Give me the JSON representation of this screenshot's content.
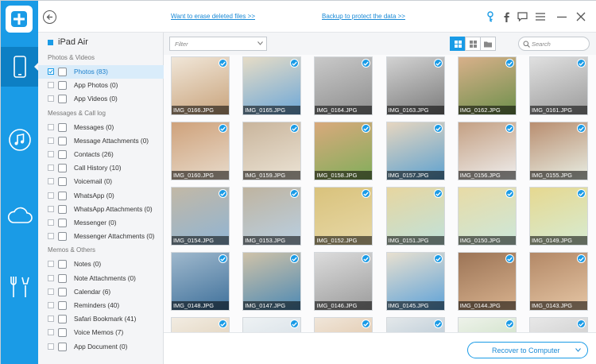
{
  "topbar": {
    "link_erase": "Want to erase deleted files >>",
    "link_backup": "Backup to protect the data >>"
  },
  "sidebar": {
    "device": "iPad Air",
    "sections": [
      {
        "title": "Photos & Videos",
        "items": [
          {
            "label": "Photos (83)",
            "selected": true,
            "icon": "photo-icon"
          },
          {
            "label": "App Photos (0)",
            "selected": false,
            "icon": "app-photo-icon"
          },
          {
            "label": "App Videos (0)",
            "selected": false,
            "icon": "app-video-icon"
          }
        ]
      },
      {
        "title": "Messages & Call log",
        "items": [
          {
            "label": "Messages (0)",
            "selected": false,
            "icon": "message-icon"
          },
          {
            "label": "Message Attachments (0)",
            "selected": false,
            "icon": "attachment-icon"
          },
          {
            "label": "Contacts (26)",
            "selected": false,
            "icon": "contact-icon"
          },
          {
            "label": "Call History (10)",
            "selected": false,
            "icon": "phone-icon"
          },
          {
            "label": "Voicemail (0)",
            "selected": false,
            "icon": "voicemail-icon"
          },
          {
            "label": "WhatsApp (0)",
            "selected": false,
            "icon": "whatsapp-icon"
          },
          {
            "label": "WhatsApp Attachments (0)",
            "selected": false,
            "icon": "whatsapp-attachment-icon"
          },
          {
            "label": "Messenger (0)",
            "selected": false,
            "icon": "messenger-icon"
          },
          {
            "label": "Messenger Attachments (0)",
            "selected": false,
            "icon": "messenger-attachment-icon"
          }
        ]
      },
      {
        "title": "Memos & Others",
        "items": [
          {
            "label": "Notes (0)",
            "selected": false,
            "icon": "notes-icon"
          },
          {
            "label": "Note Attachments (0)",
            "selected": false,
            "icon": "note-attachment-icon"
          },
          {
            "label": "Calendar (6)",
            "selected": false,
            "icon": "calendar-icon"
          },
          {
            "label": "Reminders (40)",
            "selected": false,
            "icon": "reminder-icon"
          },
          {
            "label": "Safari Bookmark (41)",
            "selected": false,
            "icon": "bookmark-icon"
          },
          {
            "label": "Voice Memos (7)",
            "selected": false,
            "icon": "voice-memo-icon"
          },
          {
            "label": "App Document (0)",
            "selected": false,
            "icon": "document-icon"
          }
        ]
      }
    ]
  },
  "toolbar": {
    "filter_value": "Filter",
    "search_placeholder": "Search"
  },
  "photos": [
    {
      "name": "IMG_0166.JPG",
      "checked": true,
      "c1": "#c8a27a",
      "c2": "#f0e6d8"
    },
    {
      "name": "IMG_0165.JPG",
      "checked": true,
      "c1": "#6aa6d8",
      "c2": "#e6dcc6"
    },
    {
      "name": "IMG_0164.JPG",
      "checked": true,
      "c1": "#8d8d8d",
      "c2": "#c9c9c9"
    },
    {
      "name": "IMG_0163.JPG",
      "checked": true,
      "c1": "#7a7a7a",
      "c2": "#d2d2d2"
    },
    {
      "name": "IMG_0162.JPG",
      "checked": true,
      "c1": "#6b8f4a",
      "c2": "#d8b08a"
    },
    {
      "name": "IMG_0161.JPG",
      "checked": true,
      "c1": "#9a9a9a",
      "c2": "#e0e0e0"
    },
    {
      "name": "IMG_0160.JPG",
      "checked": true,
      "c1": "#e8dccd",
      "c2": "#cfa27b"
    },
    {
      "name": "IMG_0159.JPG",
      "checked": true,
      "c1": "#ece4d6",
      "c2": "#c9b59c"
    },
    {
      "name": "IMG_0158.JPG",
      "checked": true,
      "c1": "#7fae5a",
      "c2": "#d9a97c"
    },
    {
      "name": "IMG_0157.JPG",
      "checked": true,
      "c1": "#5aa0d0",
      "c2": "#e6d6c0"
    },
    {
      "name": "IMG_0156.JPG",
      "checked": true,
      "c1": "#f0f0f0",
      "c2": "#c4a083"
    },
    {
      "name": "IMG_0155.JPG",
      "checked": true,
      "c1": "#e9f0e6",
      "c2": "#b98e70"
    },
    {
      "name": "IMG_0154.JPG",
      "checked": true,
      "c1": "#8fb4d4",
      "c2": "#c2b8a6"
    },
    {
      "name": "IMG_0153.JPG",
      "checked": true,
      "c1": "#b9d0e4",
      "c2": "#bfb4a0"
    },
    {
      "name": "IMG_0152.JPG",
      "checked": true,
      "c1": "#e7d9a8",
      "c2": "#d9c27c"
    },
    {
      "name": "IMG_0151.JPG",
      "checked": true,
      "c1": "#bfe2dc",
      "c2": "#e7d6a0"
    },
    {
      "name": "IMG_0150.JPG",
      "checked": true,
      "c1": "#cbe8dc",
      "c2": "#e8dba6"
    },
    {
      "name": "IMG_0149.JPG",
      "checked": true,
      "c1": "#d6ecd4",
      "c2": "#e6d890"
    },
    {
      "name": "IMG_0148.JPG",
      "checked": true,
      "c1": "#3d6f9a",
      "c2": "#9fb8cc"
    },
    {
      "name": "IMG_0147.JPG",
      "checked": true,
      "c1": "#4a88b4",
      "c2": "#cfc2a8"
    },
    {
      "name": "IMG_0146.JPG",
      "checked": true,
      "c1": "#9a9a9a",
      "c2": "#dcdcdc"
    },
    {
      "name": "IMG_0145.JPG",
      "checked": true,
      "c1": "#5aa0d8",
      "c2": "#e8e0d0"
    },
    {
      "name": "IMG_0144.JPG",
      "checked": true,
      "c1": "#d9b38f",
      "c2": "#9c7456"
    },
    {
      "name": "IMG_0143.JPG",
      "checked": true,
      "c1": "#e6c7a6",
      "c2": "#b38866"
    },
    {
      "name": "",
      "checked": true,
      "c1": "#d6c2a4",
      "c2": "#f2ece2"
    },
    {
      "name": "",
      "checked": true,
      "c1": "#c8d4de",
      "c2": "#eef2f4"
    },
    {
      "name": "",
      "checked": true,
      "c1": "#d8b48c",
      "c2": "#f0e6da"
    },
    {
      "name": "",
      "checked": true,
      "c1": "#9ab4c8",
      "c2": "#e4e8ea"
    },
    {
      "name": "",
      "checked": true,
      "c1": "#b8d6b0",
      "c2": "#eef2ea"
    },
    {
      "name": "",
      "checked": true,
      "c1": "#bcbcbc",
      "c2": "#e8e8e8"
    }
  ],
  "bottom": {
    "recover_label": "Recover to Computer"
  },
  "colors": {
    "accent": "#1a9be6",
    "accent_dark": "#0d7fc4",
    "link": "#1a8ad6"
  }
}
